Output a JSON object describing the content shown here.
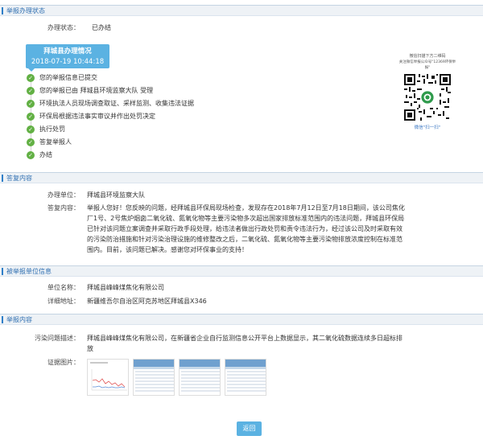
{
  "sections": {
    "status": "举报办理状态",
    "reply": "答复内容",
    "reported_unit": "被举报单位信息",
    "report": "举报内容"
  },
  "status": {
    "label": "办理状态：",
    "value": "已办结",
    "box_title": "拜城县办理情况",
    "box_time": "2018-07-19 10:44:18",
    "steps": [
      "您的举报信息已提交",
      "您的举报已由 拜城县环境监察大队 受理",
      "环境执法人员现场调查取证、采样监测、收集违法证据",
      "环保局根据违法事实审议并作出处罚决定",
      "执行处罚",
      "答复举报人",
      "办结"
    ],
    "step_icon": "check-icon"
  },
  "qr": {
    "caption1": "微信扫描下方二维码",
    "caption2": "关注微信举报公众号\"12369环保举报\"",
    "caption3": "微信\"扫一扫\""
  },
  "reply": {
    "unit_label": "办理单位：",
    "unit_value": "拜城县环境监察大队",
    "content_label": "答复内容：",
    "content_lines": [
      "举报人您好！您反映的问题，经拜城县环保局现场检查，发现存在2018年7月12日至7月18日期间，该公司焦化",
      "厂1号、2号焦炉烟囱二氧化硫、氮氧化物等主要污染物多次超出国家排放标准范围内的违法问题，拜城县环保局",
      "已针对该问题立案调查并采取行政手段处理，给违法者做出行政处罚和责令违法行为，经过该公司及时采取有效",
      "的污染防治措施和针对污染治理设施的维修整改之后，二氧化硫、氮氧化物等主要污染物排放浓度控制在标准范",
      "围内。目前，该问题已解决。感谢您对环保事业的支持！"
    ]
  },
  "reported_unit": {
    "name_label": "单位名称：",
    "name_value": "拜城县峰峰煤焦化有限公司",
    "address_label": "详细地址：",
    "address_value": "新疆维吾尔自治区阿克苏地区拜城县X346"
  },
  "report": {
    "issue_label": "污染问题描述：",
    "issue_lines": [
      "拜城县峰峰煤焦化有限公司，在新疆省企业自行监测信息公开平台上数据显示，其二氧化硫数据连续多日超标排",
      "放"
    ],
    "evidence_label": "证据图片："
  },
  "back_button": "返回",
  "colors": {
    "accent": "#5bb2e2",
    "check": "#62b044",
    "section_title": "#2f6fb1"
  }
}
